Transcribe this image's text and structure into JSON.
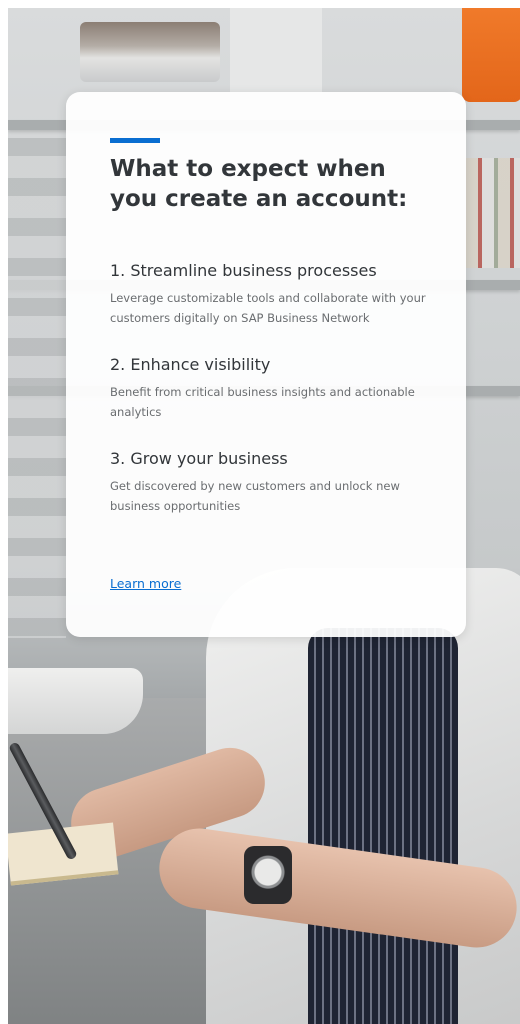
{
  "colors": {
    "accent": "#0a6ed1",
    "title_text": "#32363a",
    "body_text": "#6a6d70",
    "link": "#0a6ed1"
  },
  "card": {
    "title": "What to expect when you create an account:",
    "steps": [
      {
        "title": "1. Streamline business processes",
        "description": "Leverage customizable tools and collaborate with your customers digitally on SAP Business Network"
      },
      {
        "title": "2. Enhance visibility",
        "description": "Benefit from critical business insights and actionable analytics"
      },
      {
        "title": "3. Grow your business",
        "description": "Get discovered by new customers and unlock new business opportunities"
      }
    ],
    "link_label": "Learn more"
  }
}
